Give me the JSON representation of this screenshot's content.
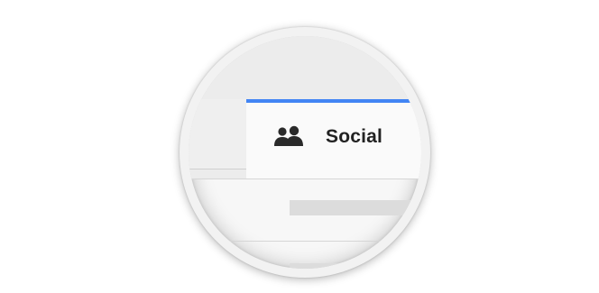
{
  "tabs": {
    "active": {
      "icon": "people-icon",
      "label": "Social"
    }
  },
  "colors": {
    "accent": "#4285f4",
    "label": "#222222"
  }
}
